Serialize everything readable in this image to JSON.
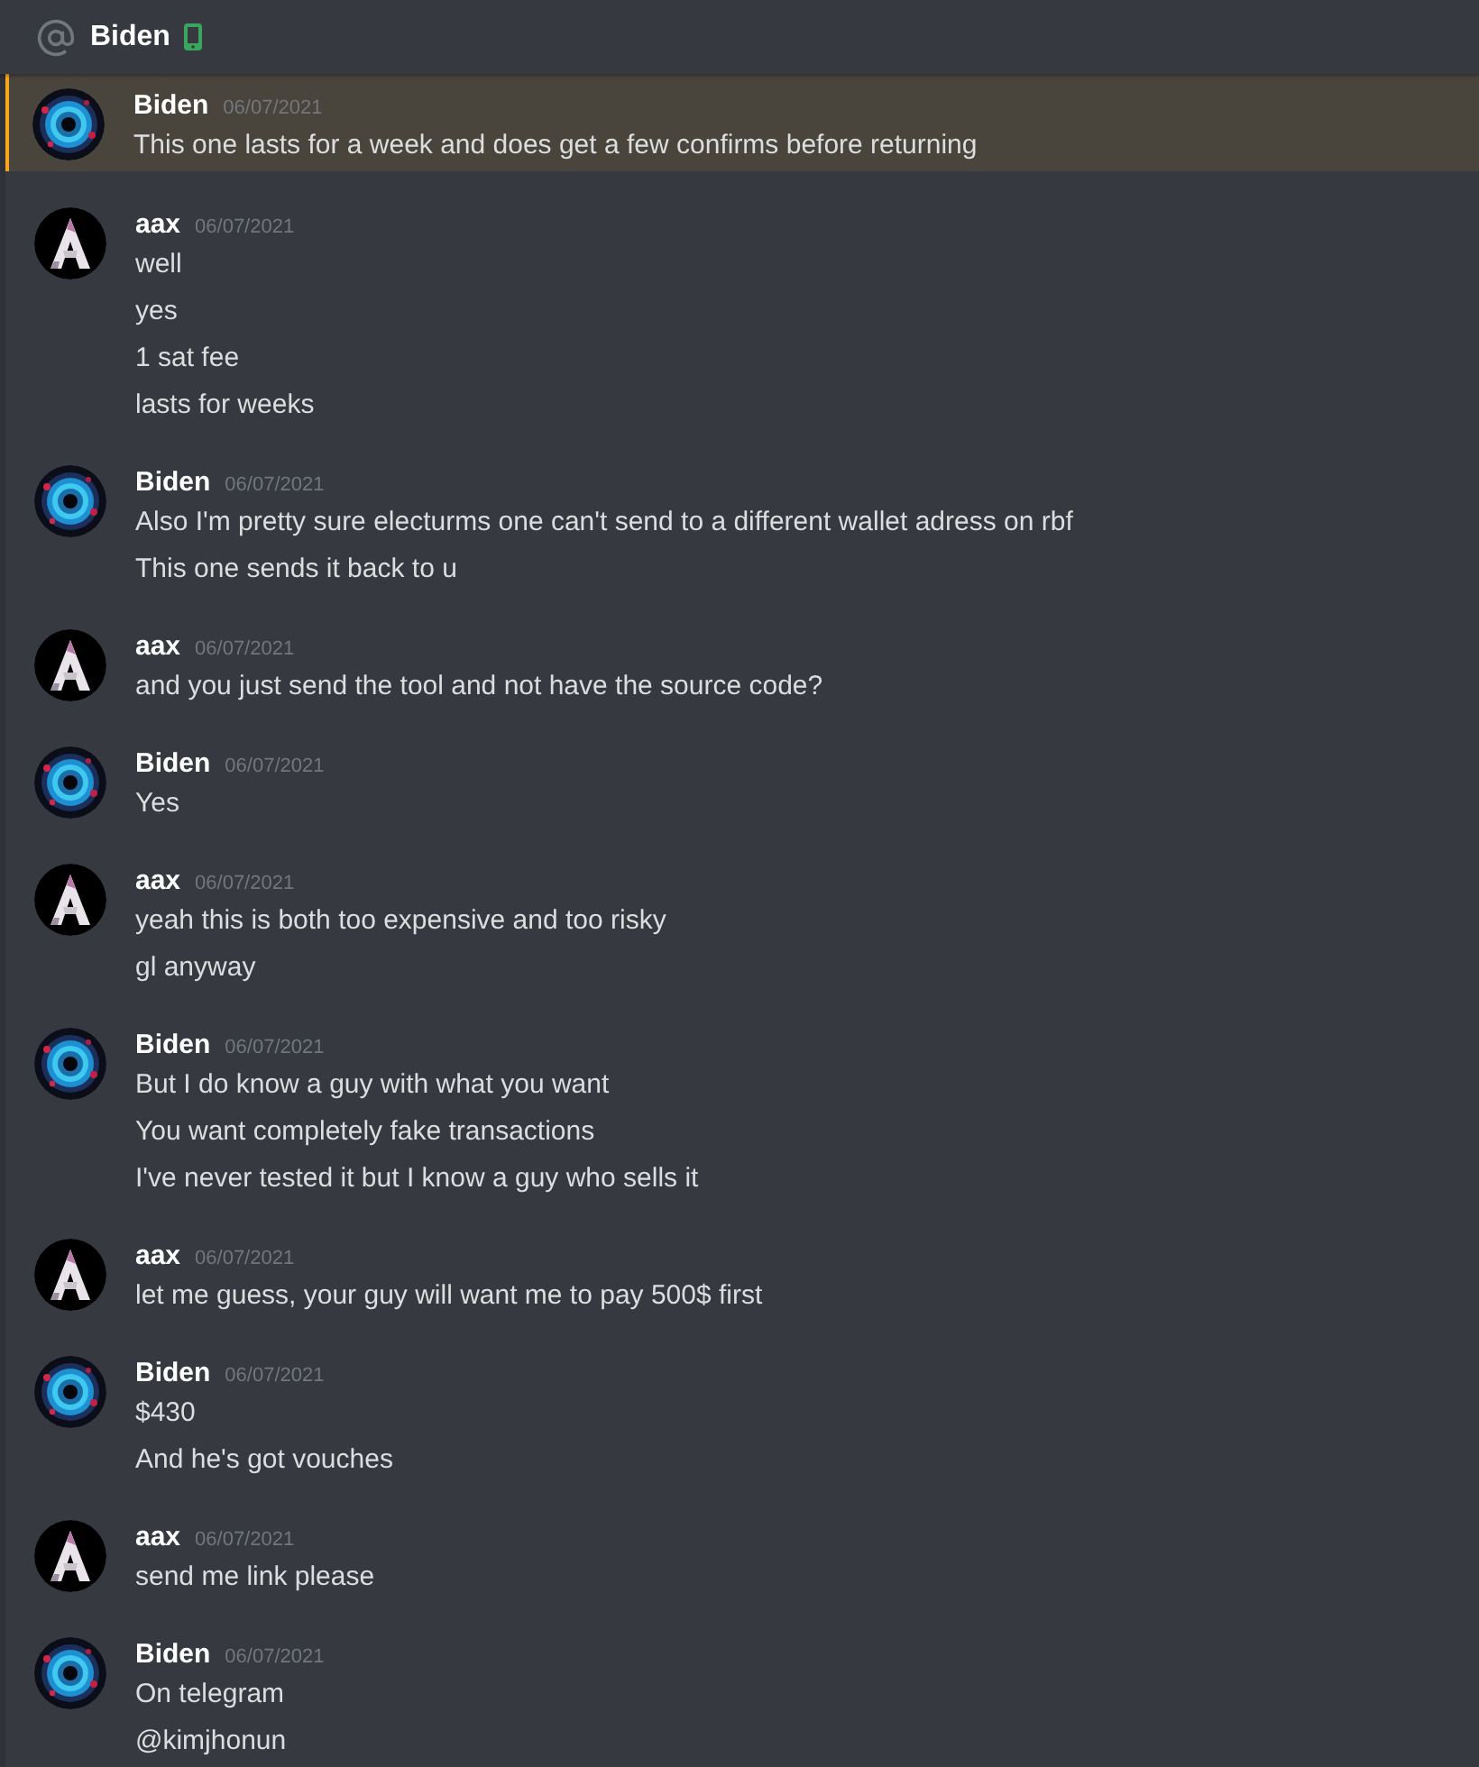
{
  "header": {
    "title": "Biden",
    "status": {
      "kind": "mobile"
    }
  },
  "groups": [
    {
      "author": "Biden",
      "kind": "vortex",
      "timestamp": "06/07/2021",
      "highlighted": true,
      "lines": [
        "This one lasts for a week and does get a few confirms before returning"
      ]
    },
    {
      "author": "aax",
      "kind": "peak",
      "timestamp": "06/07/2021",
      "highlighted": false,
      "lines": [
        "well",
        "yes",
        "1 sat fee",
        "lasts for weeks"
      ]
    },
    {
      "author": "Biden",
      "kind": "vortex",
      "timestamp": "06/07/2021",
      "highlighted": false,
      "lines": [
        "Also I'm pretty sure electurms one can't send to a different wallet adress on rbf",
        "This one sends it back to u"
      ]
    },
    {
      "author": "aax",
      "kind": "peak",
      "timestamp": "06/07/2021",
      "highlighted": false,
      "lines": [
        "and you just send the tool and not have the source code?"
      ]
    },
    {
      "author": "Biden",
      "kind": "vortex",
      "timestamp": "06/07/2021",
      "highlighted": false,
      "lines": [
        "Yes"
      ]
    },
    {
      "author": "aax",
      "kind": "peak",
      "timestamp": "06/07/2021",
      "highlighted": false,
      "lines": [
        "yeah this is both too expensive and too risky",
        "gl anyway"
      ]
    },
    {
      "author": "Biden",
      "kind": "vortex",
      "timestamp": "06/07/2021",
      "highlighted": false,
      "lines": [
        "But I do know a guy with what you want",
        "You want completely fake transactions",
        "I've never tested it but I know a guy who sells it"
      ]
    },
    {
      "author": "aax",
      "kind": "peak",
      "timestamp": "06/07/2021",
      "highlighted": false,
      "lines": [
        "let me guess, your guy will want me to pay 500$ first"
      ]
    },
    {
      "author": "Biden",
      "kind": "vortex",
      "timestamp": "06/07/2021",
      "highlighted": false,
      "lines": [
        "$430",
        "And he's got vouches"
      ]
    },
    {
      "author": "aax",
      "kind": "peak",
      "timestamp": "06/07/2021",
      "highlighted": false,
      "lines": [
        "send me link please"
      ]
    },
    {
      "author": "Biden",
      "kind": "vortex",
      "timestamp": "06/07/2021",
      "highlighted": false,
      "lines": [
        "On telegram",
        "@kimjhonun"
      ]
    }
  ]
}
